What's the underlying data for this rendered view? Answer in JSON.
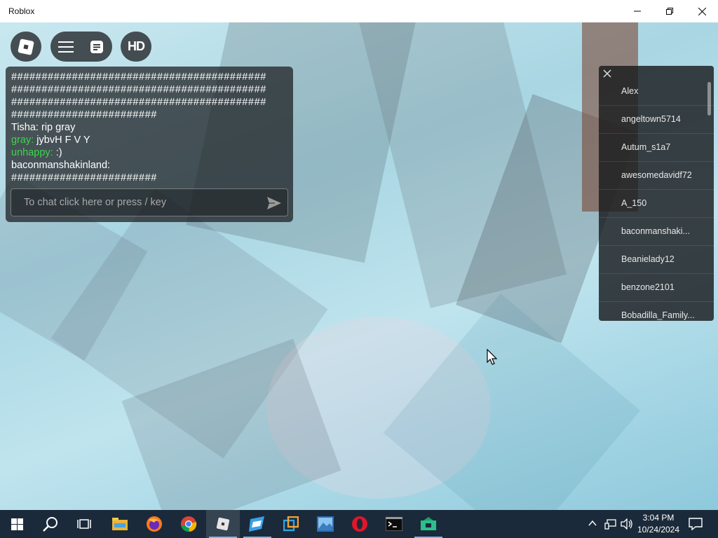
{
  "window": {
    "title": "Roblox"
  },
  "topbar": {
    "roblox_icon": "roblox-logo-icon",
    "menu_icon": "hamburger-menu-icon",
    "chat_icon": "chat-bubble-icon",
    "hd_label": "HD"
  },
  "chat": {
    "lines": [
      {
        "name": "",
        "text": "##########################################"
      },
      {
        "name": "",
        "text": "##########################################"
      },
      {
        "name": "",
        "text": "##########################################"
      },
      {
        "name": "",
        "text": "########################"
      },
      {
        "name": "Tisha:",
        "text": "rip gray"
      },
      {
        "name": "gray:",
        "text": "jybvH F V Y"
      },
      {
        "name": "unhappy:",
        "text": ":)"
      },
      {
        "name": "baconmanshakinland:",
        "text": ""
      },
      {
        "name": "",
        "text": "########################"
      }
    ],
    "input_placeholder": "To chat click here or press / key"
  },
  "players": {
    "list": [
      "Alex",
      "angeltown5714",
      "Autum_s1a7",
      "awesomedavidf72",
      "A_150",
      "baconmanshaki...",
      "Beanielady12",
      "benzone2101",
      "Bobadilla_Family..."
    ]
  },
  "taskbar": {
    "time": "3:04 PM",
    "date": "10/24/2024"
  },
  "colors": {
    "chat_green": "#3bd64a",
    "taskbar_bg": "#1b2a3a"
  }
}
